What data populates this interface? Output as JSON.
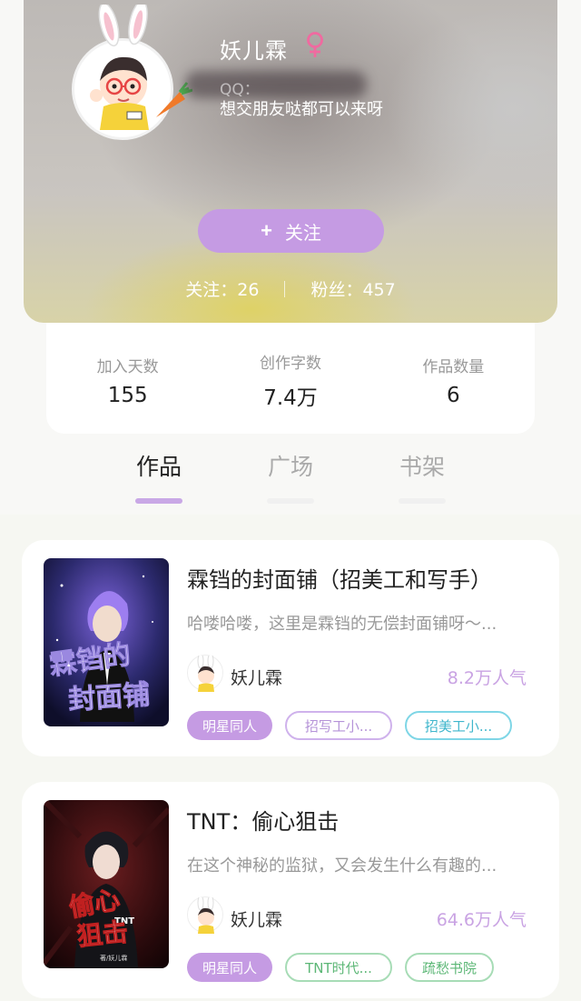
{
  "profile": {
    "name": "妖儿霖",
    "gender_symbol": "♀",
    "qq": "QQ：",
    "bio": "想交朋友哒都可以来呀",
    "follow_button": "关注",
    "follow_plus": "+",
    "following_label": "关注：26",
    "fans_label": "粉丝：457"
  },
  "stats": [
    {
      "label": "加入天数",
      "value": "155"
    },
    {
      "label": "创作字数",
      "value": "7.4万"
    },
    {
      "label": "作品数量",
      "value": "6"
    }
  ],
  "tabs": [
    {
      "label": "作品",
      "active": true
    },
    {
      "label": "广场",
      "active": false
    },
    {
      "label": "书架",
      "active": false
    }
  ],
  "books": [
    {
      "title": "霖铛的封面铺（招美工和写手）",
      "description": "哈喽哈喽，这里是霖铛的无偿封面铺呀～...",
      "author": "妖儿霖",
      "popularity": "8.2万人气",
      "cover_text": [
        "霖铛的",
        "封面铺"
      ],
      "tags": [
        "明星同人",
        "招写工小...",
        "招美工小..."
      ]
    },
    {
      "title": "TNT：偷心狙击",
      "description": "在这个神秘的监狱，又会发生什么有趣的...",
      "author": "妖儿霖",
      "popularity": "64.6万人气",
      "cover_text": [
        "偷心",
        "TNT",
        "狙击",
        "著/妖儿霖"
      ],
      "tags": [
        "明星同人",
        "TNT时代...",
        "疏愁书院"
      ]
    }
  ],
  "colors": {
    "accent": "#c59be3",
    "tab_active_underline": "#c9a8e6",
    "popularity": "#c9a3e3"
  }
}
